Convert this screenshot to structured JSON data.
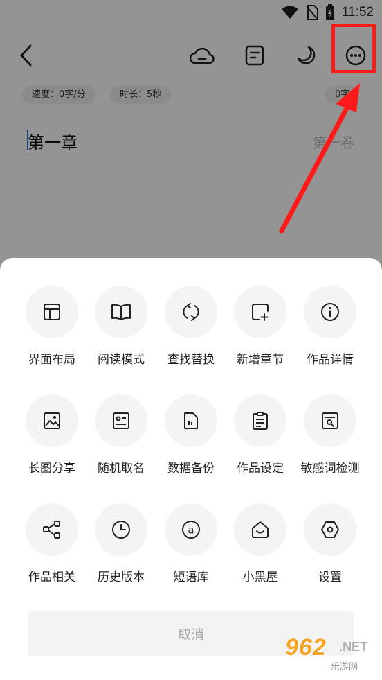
{
  "status_bar": {
    "time": "11:52"
  },
  "editor": {
    "chips": {
      "speed": "速度：0字/分",
      "duration": "时长：5秒",
      "word_count": "0字"
    },
    "chapter_title": "第一章",
    "volume_label": "第一卷"
  },
  "menu": {
    "rows": [
      [
        {
          "label": "界面布局",
          "icon": "layout-icon"
        },
        {
          "label": "阅读模式",
          "icon": "book-icon"
        },
        {
          "label": "查找替换",
          "icon": "replace-icon"
        },
        {
          "label": "新增章节",
          "icon": "add-chapter-icon"
        },
        {
          "label": "作品详情",
          "icon": "info-icon"
        }
      ],
      [
        {
          "label": "长图分享",
          "icon": "image-icon"
        },
        {
          "label": "随机取名",
          "icon": "id-card-icon"
        },
        {
          "label": "数据备份",
          "icon": "backup-icon"
        },
        {
          "label": "作品设定",
          "icon": "clipboard-icon"
        },
        {
          "label": "敏感词检测",
          "icon": "doc-search-icon"
        }
      ],
      [
        {
          "label": "作品相关",
          "icon": "share-icon"
        },
        {
          "label": "历史版本",
          "icon": "clock-icon"
        },
        {
          "label": "短语库",
          "icon": "at-icon"
        },
        {
          "label": "小黑屋",
          "icon": "house-icon"
        },
        {
          "label": "设置",
          "icon": "settings-icon"
        }
      ]
    ],
    "cancel_label": "取消"
  },
  "watermark": {
    "brand": "962",
    "suffix": ".NET",
    "site": "乐游网"
  },
  "colors": {
    "annotation": "#ff1a1a",
    "caret": "#2a6fd6",
    "watermark": "#f7a325"
  }
}
